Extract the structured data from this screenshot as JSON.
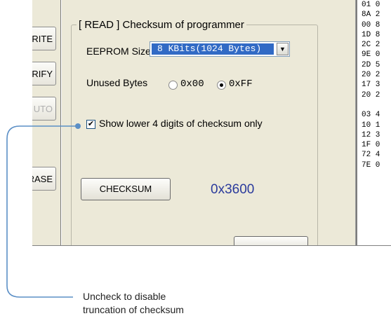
{
  "sidebar": {
    "buttons": [
      {
        "label": "RITE",
        "enabled": true
      },
      {
        "label": "ERIFY",
        "enabled": true
      },
      {
        "label": "UTO",
        "enabled": false
      },
      {
        "label": "RASE",
        "enabled": true
      }
    ]
  },
  "dialog": {
    "group_title": "[ READ ] Checksum of programmer",
    "eeprom_label": "EEPROM Size",
    "eeprom_value": "8 KBits(1024 Bytes)",
    "unused_label": "Unused Bytes",
    "unused_options": [
      {
        "label": "0x00",
        "selected": false
      },
      {
        "label": "0xFF",
        "selected": true
      }
    ],
    "checkbox_label": "Show lower 4 digits of checksum only",
    "checkbox_checked": true,
    "checksum_button": "CHECKSUM",
    "checksum_value": "0x3600"
  },
  "hex_panel": {
    "rows": [
      "01 0",
      "8A 2",
      "00 8",
      "1D 8",
      "2C 2",
      "9E 0",
      "2D 5",
      "20 2",
      "17 3",
      "20 2",
      "",
      "03 4",
      "10 1",
      "12 3",
      "1F 0",
      "72 4",
      "7E 0"
    ]
  },
  "callout": {
    "line1": "Uncheck to disable",
    "line2": "truncation of checksum",
    "color": "#5b8fc6"
  }
}
